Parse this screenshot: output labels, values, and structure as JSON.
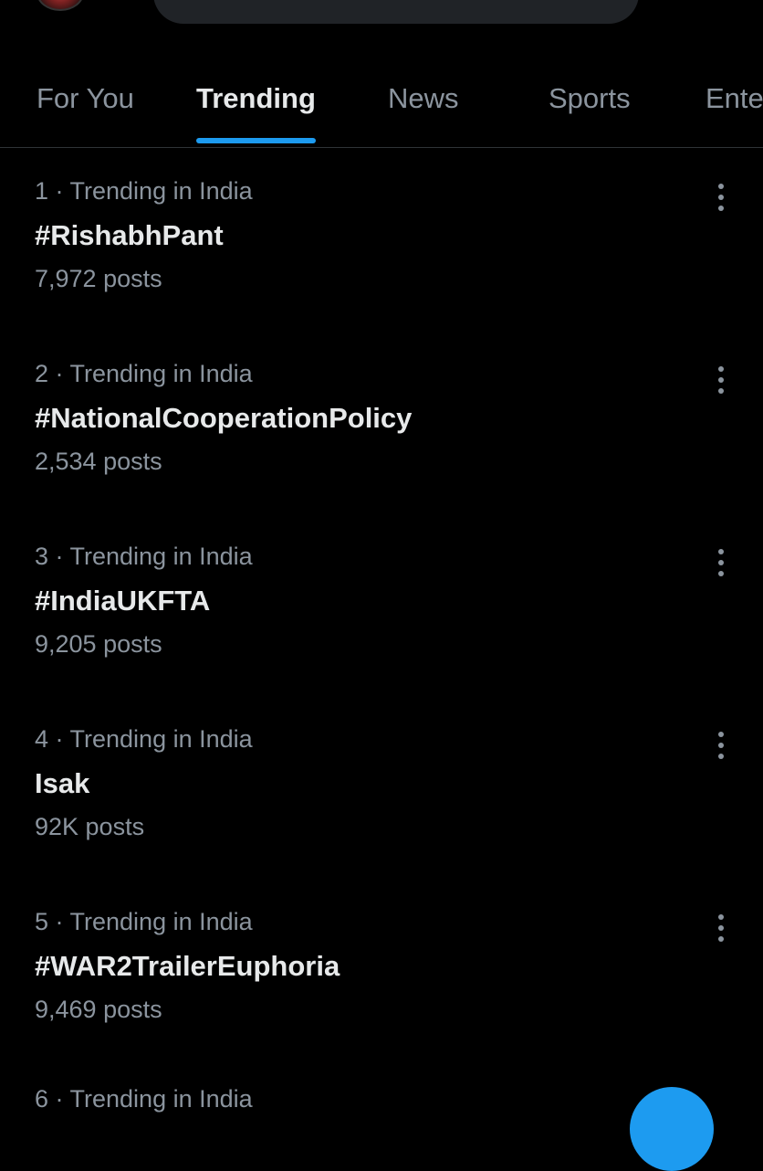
{
  "tabs": [
    {
      "label": "For You"
    },
    {
      "label": "Trending",
      "active": true
    },
    {
      "label": "News"
    },
    {
      "label": "Sports"
    },
    {
      "label": "Ente"
    }
  ],
  "trends": [
    {
      "meta": "1 · Trending in India",
      "name": "#RishabhPant",
      "count": "7,972 posts"
    },
    {
      "meta": "2 · Trending in India",
      "name": "#NationalCooperationPolicy",
      "count": "2,534 posts"
    },
    {
      "meta": "3 · Trending in India",
      "name": "#IndiaUKFTA",
      "count": "9,205 posts"
    },
    {
      "meta": "4 · Trending in India",
      "name": "Isak",
      "count": "92K posts"
    },
    {
      "meta": "5 · Trending in India",
      "name": "#WAR2TrailerEuphoria",
      "count": "9,469 posts"
    }
  ],
  "partial_trend_meta": "6 · Trending in India",
  "colors": {
    "accent": "#1d9bf0",
    "background": "#000000",
    "muted": "#8b949e"
  },
  "icons": {
    "settings": "gear-icon",
    "more": "more-options-icon",
    "compose": "compose-icon"
  }
}
